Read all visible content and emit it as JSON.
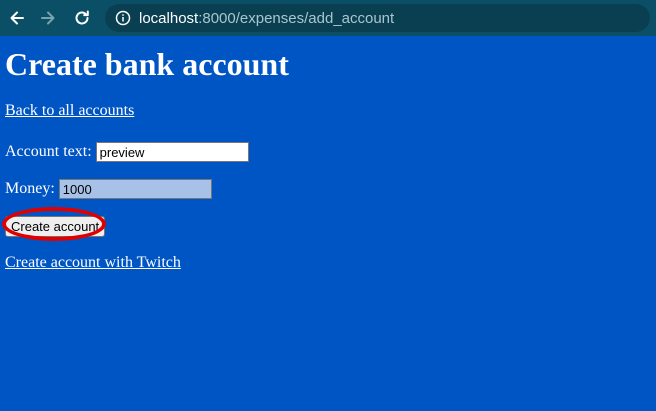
{
  "browser": {
    "url_host": "localhost",
    "url_rest": ":8000/expenses/add_account",
    "icons": {
      "back": "arrow-left-icon",
      "forward": "arrow-right-icon",
      "reload": "reload-icon",
      "site_info": "info-icon"
    }
  },
  "page": {
    "title": "Create bank account",
    "back_link": "Back to all accounts",
    "account_label": "Account text:",
    "account_value": "preview",
    "money_label": "Money:",
    "money_value": "1000",
    "submit_label": "Create account",
    "twitch_link": "Create account with Twitch"
  },
  "colors": {
    "page_background": "#0055c4",
    "toolbar_background": "#0b4f66",
    "highlight_ring": "#e00000"
  }
}
